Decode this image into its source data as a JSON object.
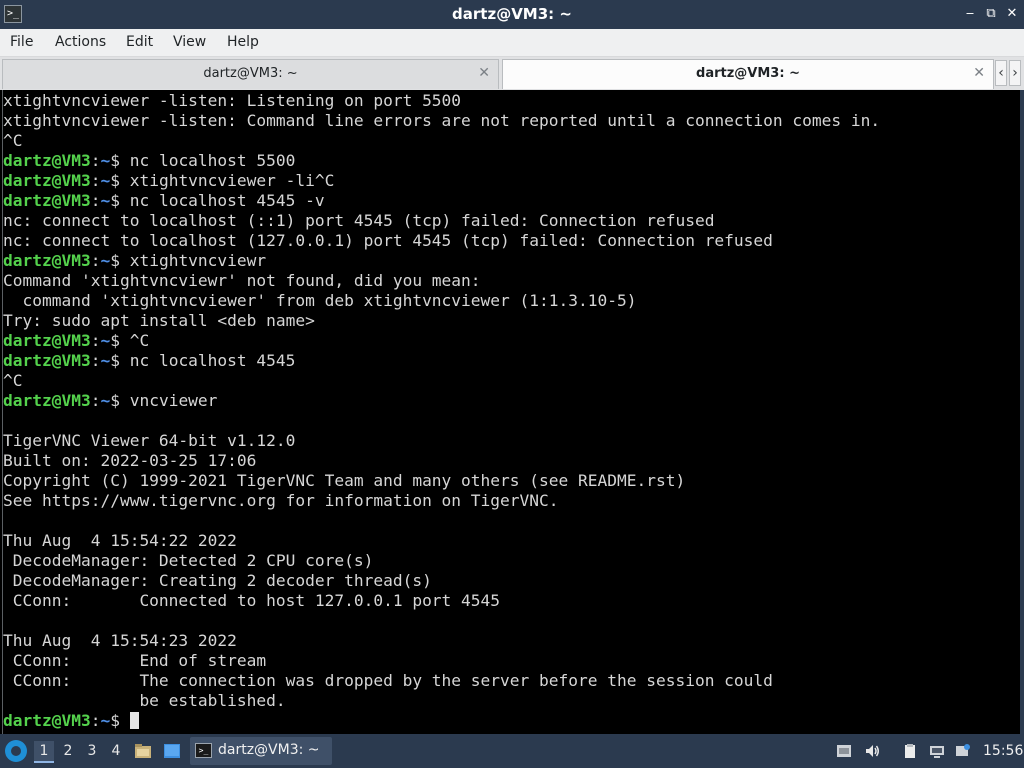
{
  "window": {
    "title": "dartz@VM3: ~",
    "minimize_glyph": "‒",
    "maximize_glyph": "⧉",
    "close_glyph": "✕",
    "app_icon_glyph": ">_"
  },
  "menu": {
    "file": "File",
    "actions": "Actions",
    "edit": "Edit",
    "view": "View",
    "help": "Help"
  },
  "tabs": [
    {
      "label": "dartz@VM3: ~",
      "active": false
    },
    {
      "label": "dartz@VM3: ~",
      "active": true
    }
  ],
  "tab_close_glyph": "✕",
  "tab_scroll": {
    "left": "‹",
    "right": "›"
  },
  "terminal": {
    "prompt_user": "dartz@VM3",
    "prompt_colon": ":",
    "prompt_path": "~",
    "lines": [
      {
        "text": "xtightvncviewer -listen: Listening on port 5500"
      },
      {
        "text": "xtightvncviewer -listen: Command line errors are not reported until a connection comes in."
      },
      {
        "text": "^C"
      },
      {
        "prompt": true,
        "cmd": "$ nc localhost 5500"
      },
      {
        "prompt": true,
        "cmd": "$ xtightvncviewer -li^C"
      },
      {
        "prompt": true,
        "cmd": "$ nc localhost 4545 -v"
      },
      {
        "text": "nc: connect to localhost (::1) port 4545 (tcp) failed: Connection refused"
      },
      {
        "text": "nc: connect to localhost (127.0.0.1) port 4545 (tcp) failed: Connection refused"
      },
      {
        "prompt": true,
        "cmd": "$ xtightvncviewr"
      },
      {
        "text": "Command 'xtightvncviewr' not found, did you mean:"
      },
      {
        "text": "  command 'xtightvncviewer' from deb xtightvncviewer (1:1.3.10-5)"
      },
      {
        "text": "Try: sudo apt install <deb name>"
      },
      {
        "prompt": true,
        "cmd": "$ ^C"
      },
      {
        "prompt": true,
        "cmd": "$ nc localhost 4545"
      },
      {
        "text": "^C"
      },
      {
        "prompt": true,
        "cmd": "$ vncviewer"
      },
      {
        "text": ""
      },
      {
        "text": "TigerVNC Viewer 64-bit v1.12.0"
      },
      {
        "text": "Built on: 2022-03-25 17:06"
      },
      {
        "text": "Copyright (C) 1999-2021 TigerVNC Team and many others (see README.rst)"
      },
      {
        "text": "See https://www.tigervnc.org for information on TigerVNC."
      },
      {
        "text": ""
      },
      {
        "text": "Thu Aug  4 15:54:22 2022"
      },
      {
        "text": " DecodeManager: Detected 2 CPU core(s)"
      },
      {
        "text": " DecodeManager: Creating 2 decoder thread(s)"
      },
      {
        "text": " CConn:       Connected to host 127.0.0.1 port 4545"
      },
      {
        "text": ""
      },
      {
        "text": "Thu Aug  4 15:54:23 2022"
      },
      {
        "text": " CConn:       End of stream"
      },
      {
        "text": " CConn:       The connection was dropped by the server before the session could"
      },
      {
        "text": "              be established."
      },
      {
        "prompt": true,
        "cmd": "$ ",
        "cursor": true
      }
    ]
  },
  "taskbar": {
    "workspaces": [
      "1",
      "2",
      "3",
      "4"
    ],
    "current_workspace": "1",
    "task_label": "dartz@VM3: ~",
    "clock": "15:56"
  }
}
